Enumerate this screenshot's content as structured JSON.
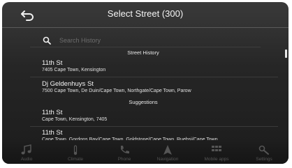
{
  "header": {
    "title": "Select Street (300)",
    "back_icon": "back-arrow-icon"
  },
  "search": {
    "placeholder": "Search History",
    "icon": "search-icon"
  },
  "sections": {
    "history": "Street History",
    "suggestions": "Suggestions"
  },
  "history_items": [
    {
      "name": "11th St",
      "address": "7405 Cape Town, Kensington"
    },
    {
      "name": "Dj Geldenhuys St",
      "address": "7500 Cape Town, De Duin/Cape Town, Northgate/Cape Town, Parow"
    }
  ],
  "suggestion_items": [
    {
      "name": "11th St",
      "address": "Cape Town, Kensington, 7405"
    },
    {
      "name": "11th St",
      "address": "Cape Town, Gordons Bay/Cape Town, Goldstone/Cape Town, Ruebsi/Cape Town"
    }
  ],
  "bottom_nav": [
    {
      "label": "Audio",
      "icon": "music-note-icon"
    },
    {
      "label": "Climate",
      "icon": "climate-icon"
    },
    {
      "label": "Phone",
      "icon": "phone-icon"
    },
    {
      "label": "Navigation",
      "icon": "navigation-icon"
    },
    {
      "label": "Mobile apps",
      "icon": "apps-grid-icon"
    },
    {
      "label": "Settings",
      "icon": "settings-icon"
    }
  ]
}
